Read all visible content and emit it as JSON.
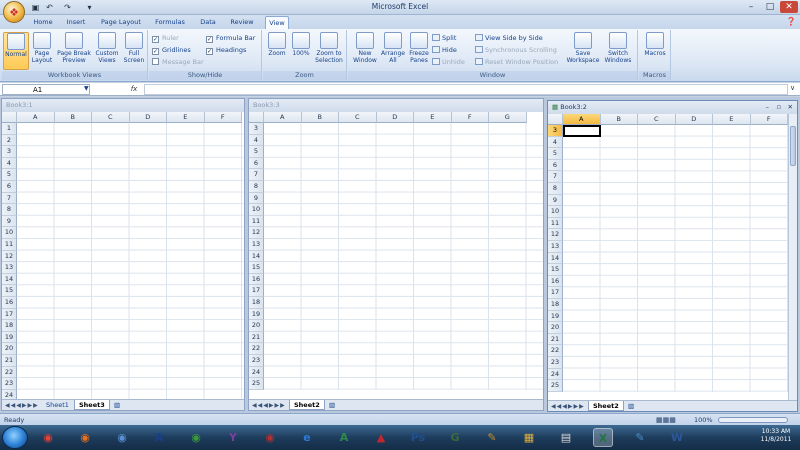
{
  "window": {
    "title": "Microsoft Excel",
    "min_icon": "minimize-icon",
    "max_icon": "maximize-icon",
    "close_icon": "close-icon"
  },
  "ribbon_tabs": [
    "Home",
    "Insert",
    "Page Layout",
    "Formulas",
    "Data",
    "Review",
    "View"
  ],
  "active_tab": "View",
  "groups": {
    "workbook_views": {
      "label": "Workbook Views",
      "buttons": [
        {
          "label": "Normal",
          "selected": true
        },
        {
          "label": "Page Layout"
        },
        {
          "label": "Page Break Preview"
        },
        {
          "label": "Custom Views"
        },
        {
          "label": "Full Screen"
        }
      ]
    },
    "show_hide": {
      "label": "Show/Hide",
      "ruler": "Ruler",
      "gridlines": "Gridlines",
      "message_bar": "Message Bar",
      "formula_bar": "Formula Bar",
      "headings": "Headings"
    },
    "zoom": {
      "label": "Zoom",
      "zoom": "Zoom",
      "hundred": "100%",
      "zoom_selection": "Zoom to Selection"
    },
    "window": {
      "label": "Window",
      "new_window": "New Window",
      "arrange_all": "Arrange All",
      "freeze_panes": "Freeze Panes",
      "split": "Split",
      "hide": "Hide",
      "unhide": "Unhide",
      "side_by_side": "View Side by Side",
      "sync_scroll": "Synchronous Scrolling",
      "reset_position": "Reset Window Position",
      "save_workspace": "Save Workspace",
      "switch_windows": "Switch Windows"
    },
    "macros": {
      "label": "Macros",
      "button": "Macros"
    }
  },
  "formula_bar": {
    "name_box": "A1",
    "fx": "fx"
  },
  "windows": [
    {
      "title": "Book3:1",
      "rows_start": 1,
      "rows_end": 24,
      "columns": [
        "A",
        "B",
        "C",
        "D",
        "E",
        "F"
      ],
      "sheet_tabs": [
        "Sheet1",
        "Sheet3"
      ],
      "active_sheet": "Sheet3"
    },
    {
      "title": "Book3:3",
      "rows_start": 3,
      "rows_end": 25,
      "columns": [
        "A",
        "B",
        "C",
        "D",
        "E",
        "F",
        "G"
      ],
      "sheet_tabs": [
        "Sheet2"
      ],
      "active_sheet": "Sheet2"
    },
    {
      "title": "Book3:2",
      "rows_start": 3,
      "rows_end": 25,
      "columns": [
        "A",
        "B",
        "C",
        "D",
        "E",
        "F"
      ],
      "sheet_tabs": [
        "Sheet2"
      ],
      "active_sheet": "Sheet2",
      "active": true
    }
  ],
  "status": {
    "ready": "Ready",
    "zoom": "100%"
  },
  "taskbar": {
    "apps": [
      "chrome-icon",
      "firefox-icon",
      "media-icon",
      "a-app-icon",
      "green-app-icon",
      "yahoo-icon",
      "bug-icon",
      "ie-icon",
      "a-green-icon",
      "acrobat-icon",
      "photoshop-icon",
      "g-app-icon",
      "pen-tool-icon",
      "folder-icon",
      "notepad-icon",
      "excel-icon",
      "paint-icon",
      "word-icon"
    ],
    "time": "10:33 AM",
    "date": "11/8/2011"
  },
  "colors": {
    "ribbon": "#dbe6f4",
    "selected_header": "#f5b840",
    "taskbar": "#1e3c5c"
  }
}
